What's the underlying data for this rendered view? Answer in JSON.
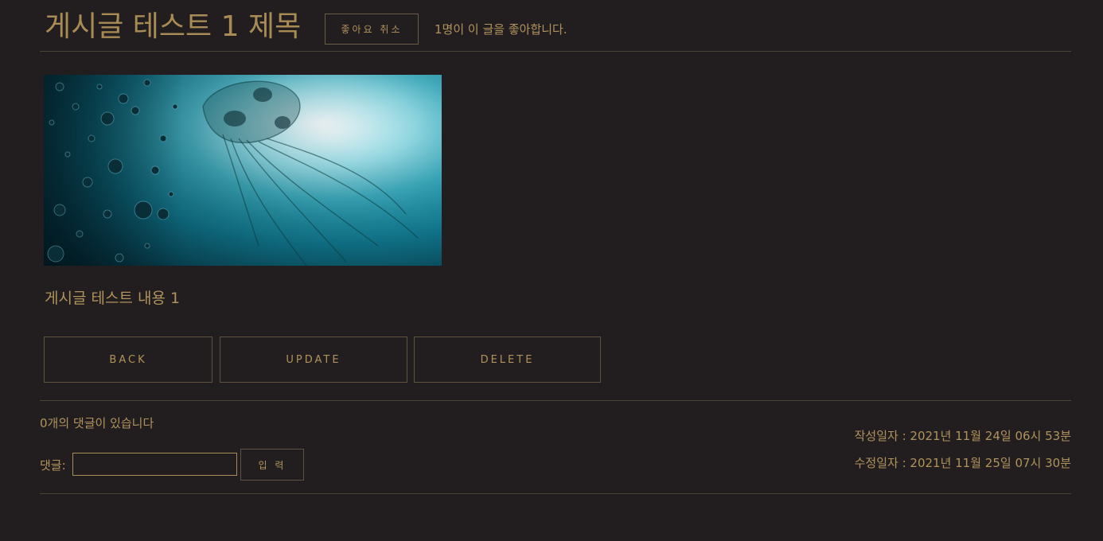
{
  "post": {
    "title": "게시글 테스트 1 제목",
    "like_button_label": "좋아요 취소",
    "like_count_text": "1명이 이 글을 좋아합니다.",
    "content": "게시글 테스트 내용 1"
  },
  "actions": {
    "back": "BACK",
    "update": "UPDATE",
    "delete": "DELETE"
  },
  "comments": {
    "count_text": "0개의 댓글이 있습니다",
    "label": "댓글:",
    "input_value": "",
    "submit_label": "입 력"
  },
  "dates": {
    "created": "작성일자 : 2021년 11월 24일 06시 53분",
    "modified": "수정일자 : 2021년 11월 25일 07시 30분"
  },
  "colors": {
    "background": "#221e1f",
    "accent_text": "#b0935c",
    "border": "#5e5342"
  }
}
